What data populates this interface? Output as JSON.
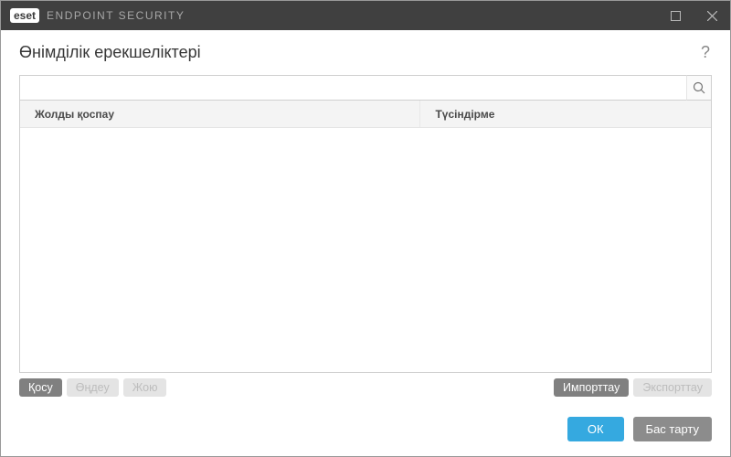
{
  "titlebar": {
    "brand": "eset",
    "app": "ENDPOINT SECURITY"
  },
  "page": {
    "title": "Өнімділік ерекшеліктері"
  },
  "search": {
    "value": "",
    "placeholder": ""
  },
  "table": {
    "columns": [
      "Жолды қоспау",
      "Түсіндірме"
    ],
    "rows": []
  },
  "toolbar": {
    "add_label": "Қосу",
    "edit_label": "Өңдеу",
    "delete_label": "Жою",
    "import_label": "Импорттау",
    "export_label": "Экспорттау"
  },
  "footer": {
    "ok_label": "ОК",
    "cancel_label": "Бас тарту"
  }
}
